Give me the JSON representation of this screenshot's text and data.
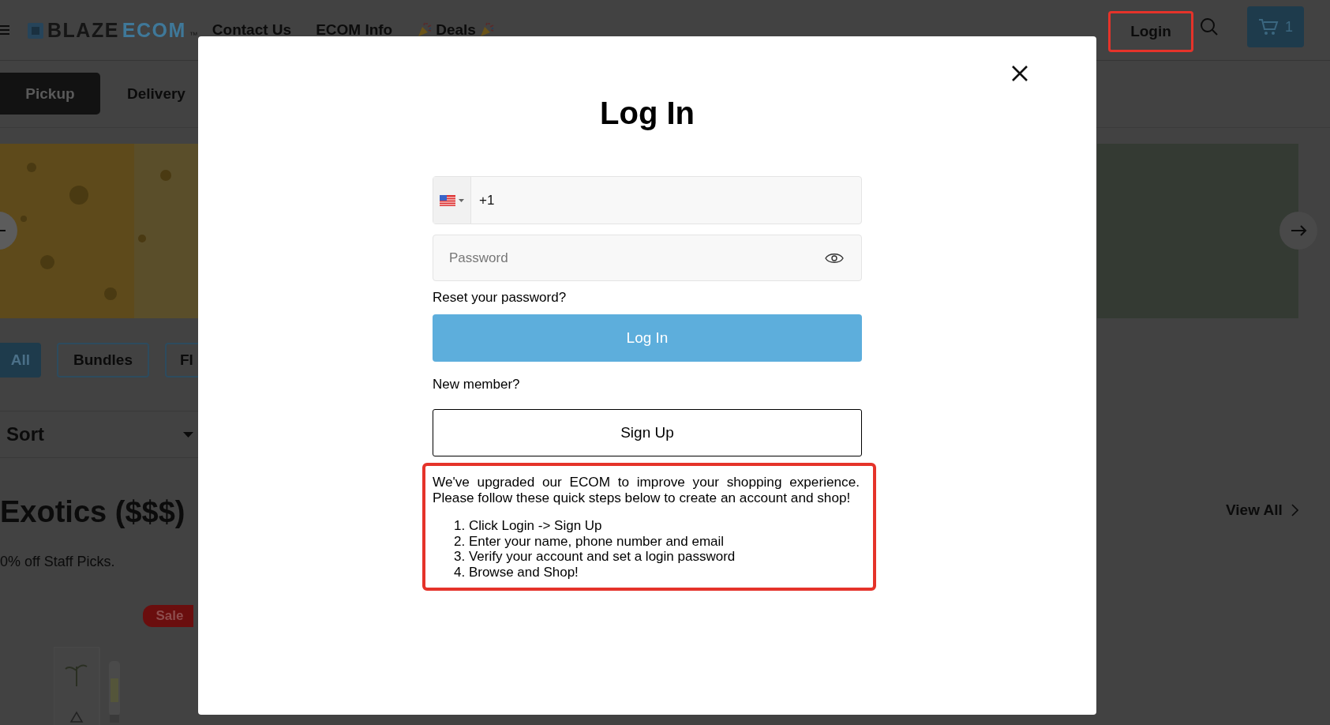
{
  "header": {
    "logo": {
      "word_1": "BLAZE",
      "word_2": "ECOM",
      "mark": "™"
    },
    "nav": [
      {
        "label": "Contact Us",
        "kind": "plain"
      },
      {
        "label": "ECOM Info",
        "kind": "plain"
      },
      {
        "label": "Deals",
        "kind": "party"
      }
    ],
    "login": "Login",
    "cart_count": "1"
  },
  "fulfillment_tabs": [
    {
      "label": "Pickup",
      "selected": true
    },
    {
      "label": "Delivery",
      "selected": false
    }
  ],
  "categories": [
    {
      "label": "All",
      "selected": true
    },
    {
      "label": "Bundles",
      "selected": false
    },
    {
      "label": "Fl",
      "selected": false
    }
  ],
  "sort": {
    "label": "Sort"
  },
  "section": {
    "title": "Exotics ($$$)",
    "subtitle": "0% off Staff Picks.",
    "view_all": "View All"
  },
  "product": {
    "badge": "Sale"
  },
  "modal": {
    "title": "Log In",
    "phone": {
      "country_code": "+1"
    },
    "password": {
      "placeholder": "Password"
    },
    "reset_link": "Reset your password?",
    "login_button": "Log In",
    "new_member": "New member?",
    "signup_button": "Sign Up",
    "notice": {
      "intro": "We've upgraded our ECOM to improve your shopping experience. Please follow these quick steps below to create an account and shop!",
      "steps": [
        "1. Click Login -> Sign Up",
        "2. Enter your name, phone number and email",
        "3. Verify your account and set a login password",
        "4. Browse and Shop!"
      ]
    }
  }
}
